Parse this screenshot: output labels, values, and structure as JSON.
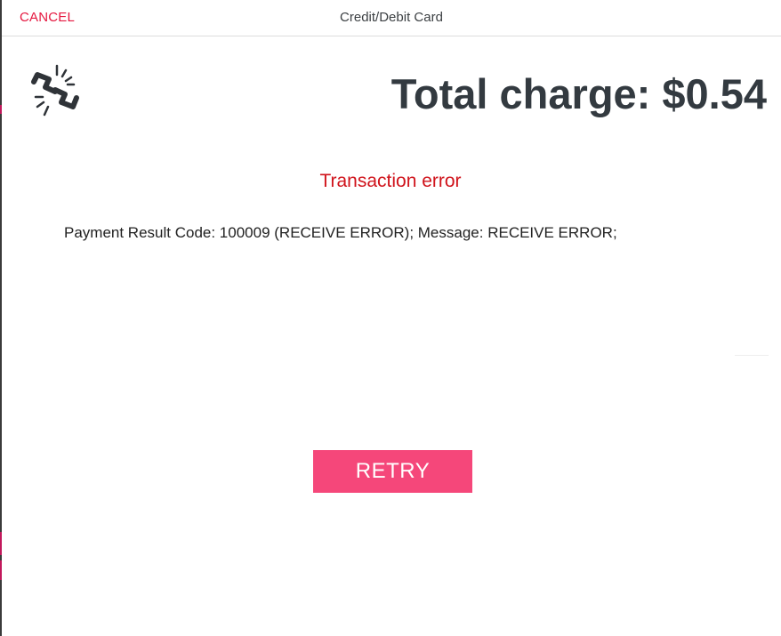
{
  "header": {
    "cancel_label": "CANCEL",
    "title": "Credit/Debit Card"
  },
  "main": {
    "icon": "broken-link-icon",
    "total_charge": "Total charge: $0.54",
    "error_title": "Transaction error",
    "error_message": "Payment Result Code: 100009 (RECEIVE ERROR); Message: RECEIVE ERROR;",
    "retry_label": "RETRY"
  },
  "colors": {
    "accent": "#e5173f",
    "error_text": "#d0131b",
    "retry_button": "#f5477a",
    "heading_text": "#333a40"
  }
}
